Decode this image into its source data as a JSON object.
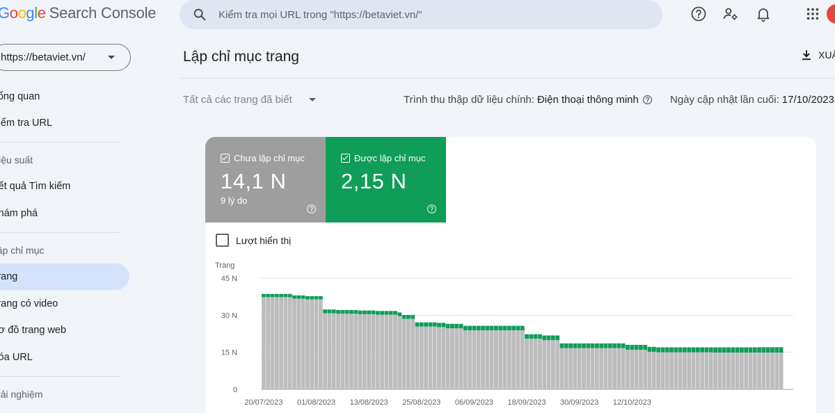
{
  "header": {
    "logo_letters": [
      {
        "ch": "G",
        "color": "#4285f4"
      },
      {
        "ch": "o",
        "color": "#ea4335"
      },
      {
        "ch": "o",
        "color": "#fbbc05"
      },
      {
        "ch": "g",
        "color": "#4285f4"
      },
      {
        "ch": "l",
        "color": "#34a853"
      },
      {
        "ch": "e",
        "color": "#ea4335"
      }
    ],
    "product_name": "Search Console",
    "search_placeholder": "Kiểm tra mọi URL trong \"https://betaviet.vn/\""
  },
  "sidebar": {
    "property": "https://betaviet.vn/",
    "items": [
      {
        "label": "Tổng quan"
      },
      {
        "label": "Kiểm tra URL"
      },
      {
        "section": "Hiệu suất"
      },
      {
        "label": "Kết quả Tìm kiếm"
      },
      {
        "label": "Khám phá"
      },
      {
        "section": "Lập chỉ mục"
      },
      {
        "label": "Trang",
        "active": true
      },
      {
        "label": "Trang có video"
      },
      {
        "label": "Sơ đồ trang web"
      },
      {
        "label": "Xóa URL"
      },
      {
        "section": "Trải nghiệm"
      }
    ]
  },
  "main": {
    "title": "Lập chỉ mục trang",
    "export_label": "XUẤT",
    "filter_label": "Tất cả các trang đã biết",
    "crawler_label": "Trình thu thập dữ liệu chính:",
    "crawler_value": "Điện thoại thông minh",
    "updated_label": "Ngày cập nhật lần cuối:",
    "updated_value": "17/10/2023"
  },
  "tiles": {
    "not_indexed": {
      "label": "Chưa lập chỉ mục",
      "value": "14,1 N",
      "sub": "9 lý do",
      "color": "#9e9e9e"
    },
    "indexed": {
      "label": "Được lập chỉ mục",
      "value": "2,15 N",
      "color": "#0f9d58"
    }
  },
  "impressions_label": "Lượt hiển thị",
  "chart_data": {
    "type": "bar",
    "stacked": true,
    "ylabel": "Trang",
    "ylim": [
      0,
      45000
    ],
    "yticks": [
      {
        "v": 0,
        "label": "0"
      },
      {
        "v": 15000,
        "label": "15 N"
      },
      {
        "v": 30000,
        "label": "30 N"
      },
      {
        "v": 45000,
        "label": "45 N"
      }
    ],
    "xtick_labels": [
      "20/07/2023",
      "01/08/2023",
      "13/08/2023",
      "25/08/2023",
      "06/09/2023",
      "18/09/2023",
      "30/09/2023",
      "12/10/2023"
    ],
    "xtick_indices": [
      0,
      12,
      24,
      36,
      48,
      60,
      72,
      84
    ],
    "series": [
      {
        "key": "not_indexed",
        "color": "#bdbdbd",
        "values": [
          37300,
          37300,
          37300,
          37300,
          37300,
          37300,
          37300,
          36700,
          36700,
          36700,
          36400,
          36400,
          36400,
          36400,
          30800,
          30800,
          30800,
          30600,
          30600,
          30600,
          30600,
          30600,
          30400,
          30400,
          30400,
          30400,
          30200,
          30200,
          30200,
          30200,
          30200,
          29600,
          28500,
          28500,
          28500,
          25400,
          25400,
          25400,
          25400,
          25400,
          25200,
          25200,
          24700,
          24700,
          24700,
          24700,
          23900,
          23900,
          23900,
          23900,
          23900,
          23900,
          23900,
          23900,
          23900,
          23900,
          23900,
          23900,
          23900,
          23900,
          20500,
          20500,
          20500,
          20500,
          19900,
          19900,
          19900,
          19900,
          16700,
          16700,
          16700,
          16700,
          16700,
          16700,
          16700,
          16700,
          16700,
          16700,
          16700,
          16700,
          16700,
          16700,
          16700,
          16000,
          16000,
          16000,
          16000,
          16000,
          15200,
          15200,
          15000,
          15000,
          15000,
          15000,
          15000,
          15000,
          15000,
          15000,
          15000,
          15000,
          15000,
          15000,
          15000,
          14900,
          14900,
          14900,
          14900,
          14900,
          14900,
          14900,
          14900,
          14900,
          14900,
          14900,
          14900,
          14900,
          14900,
          14900,
          14900
        ]
      },
      {
        "key": "indexed",
        "color": "#0f9d58",
        "values": [
          1300,
          1300,
          1300,
          1300,
          1300,
          1300,
          1300,
          1300,
          1300,
          1300,
          1300,
          1300,
          1300,
          1300,
          1500,
          1500,
          1500,
          1500,
          1500,
          1500,
          1500,
          1500,
          1500,
          1500,
          1500,
          1500,
          1500,
          1500,
          1500,
          1500,
          1500,
          1500,
          1600,
          1600,
          1600,
          1700,
          1700,
          1700,
          1700,
          1700,
          1700,
          1700,
          1800,
          1800,
          1800,
          1800,
          1800,
          1800,
          1800,
          1800,
          1800,
          1800,
          1800,
          1800,
          1800,
          1800,
          1800,
          1800,
          1800,
          1800,
          1800,
          1800,
          1800,
          1800,
          1900,
          1900,
          1900,
          1900,
          1900,
          1900,
          1900,
          1900,
          1900,
          1900,
          1900,
          1900,
          1900,
          1900,
          1900,
          1900,
          1900,
          1900,
          1900,
          2000,
          2000,
          2000,
          2000,
          2000,
          2000,
          2000,
          2000,
          2000,
          2000,
          2000,
          2000,
          2000,
          2000,
          2000,
          2000,
          2000,
          2000,
          2000,
          2000,
          2100,
          2100,
          2100,
          2100,
          2100,
          2100,
          2100,
          2100,
          2100,
          2100,
          2150,
          2150,
          2150,
          2150,
          2150,
          2150
        ]
      }
    ]
  }
}
